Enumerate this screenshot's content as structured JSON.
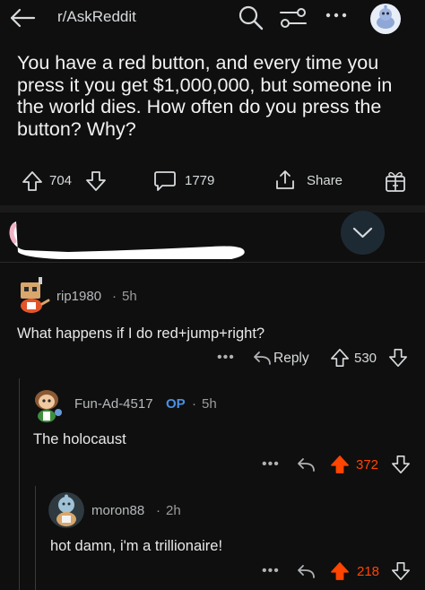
{
  "header": {
    "subreddit": "r/AskReddit",
    "icons": [
      "back-arrow-icon",
      "search-icon",
      "sort-filter-icon",
      "more-dots-icon",
      "user-avatar-icon"
    ]
  },
  "post": {
    "title": "You have a red button, and every time you press it you get $1,000,000, but someone in the world dies. How often do you press the button? Why?",
    "upvotes": "704",
    "comments": "1779",
    "share_label": "Share"
  },
  "comments": [
    {
      "user": "rip1980",
      "time": "5h",
      "text": "What happens if I do red+jump+right?",
      "reply_label": "Reply",
      "votes": "530",
      "op": false
    },
    {
      "user": "Fun-Ad-4517",
      "op_label": "OP",
      "time": "5h",
      "text": "The holocaust",
      "votes": "372",
      "upvoted": true
    },
    {
      "user": "moron88",
      "time": "2h",
      "text": "hot damn, i'm a  trillionaire!",
      "votes": "218",
      "upvoted": true
    }
  ],
  "colors": {
    "background": "#0f0f0f",
    "text": "#d7dadc",
    "upvote_active": "#ff4500",
    "op_blue": "#4a90e2",
    "collapse_button": "#1e2a33"
  }
}
